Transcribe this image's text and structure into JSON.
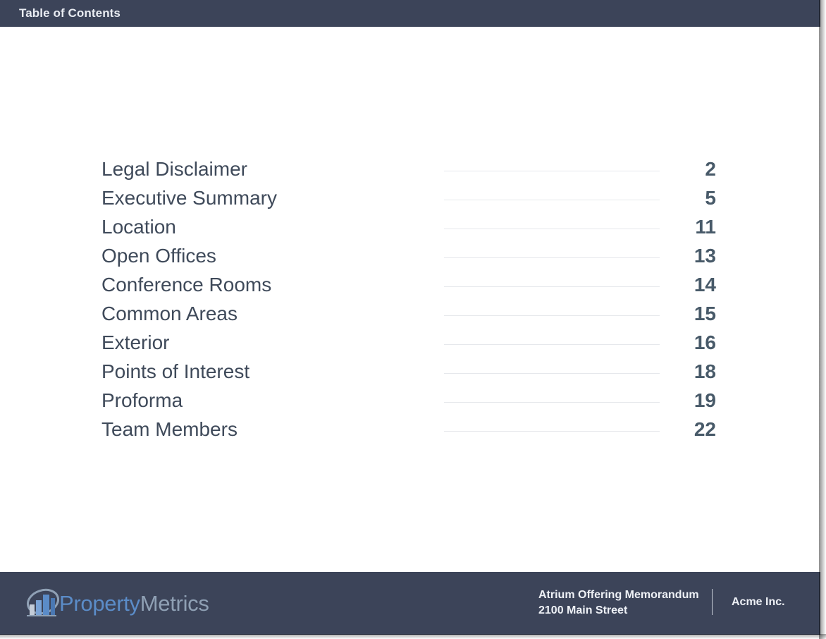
{
  "header": {
    "title": "Table of Contents"
  },
  "toc": [
    {
      "label": "Legal Disclaimer",
      "page": "2"
    },
    {
      "label": "Executive Summary",
      "page": "5"
    },
    {
      "label": "Location",
      "page": "11"
    },
    {
      "label": "Open Offices",
      "page": "13"
    },
    {
      "label": "Conference Rooms",
      "page": "14"
    },
    {
      "label": "Common Areas",
      "page": "15"
    },
    {
      "label": "Exterior",
      "page": "16"
    },
    {
      "label": "Points of Interest",
      "page": "18"
    },
    {
      "label": "Proforma",
      "page": "19"
    },
    {
      "label": "Team Members",
      "page": "22"
    }
  ],
  "footer": {
    "logo_text_part1": "Property",
    "logo_text_part2": "Metrics",
    "document_title": "Atrium Offering Memorandum",
    "address": "2100 Main Street",
    "company": "Acme Inc."
  },
  "colors": {
    "bar_background": "#3c4459",
    "toc_label": "#3f4a5a",
    "toc_page": "#485a69",
    "logo_blue": "#5b8cc8",
    "logo_gray": "#8fa0b4"
  }
}
